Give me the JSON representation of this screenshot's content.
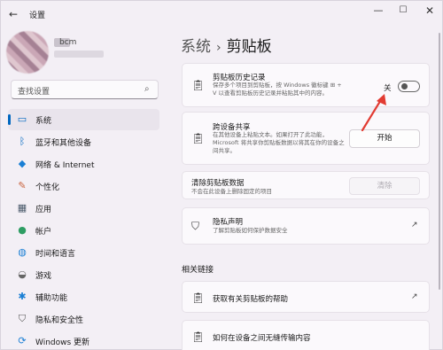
{
  "window": {
    "title": "设置",
    "controls": {
      "minimize": "—",
      "maximize": "☐",
      "close": "✕"
    }
  },
  "account": {
    "name": "bcm"
  },
  "search": {
    "placeholder": "查找设置"
  },
  "nav": {
    "items": [
      {
        "label": "系统",
        "icon": "monitor-icon",
        "active": true
      },
      {
        "label": "蓝牙和其他设备",
        "icon": "bluetooth-icon"
      },
      {
        "label": "网络 & Internet",
        "icon": "wifi-icon"
      },
      {
        "label": "个性化",
        "icon": "brush-icon"
      },
      {
        "label": "应用",
        "icon": "apps-icon"
      },
      {
        "label": "帐户",
        "icon": "person-icon"
      },
      {
        "label": "时间和语言",
        "icon": "globe-clock-icon"
      },
      {
        "label": "游戏",
        "icon": "gamepad-icon"
      },
      {
        "label": "辅助功能",
        "icon": "accessibility-icon"
      },
      {
        "label": "隐私和安全性",
        "icon": "shield-icon"
      },
      {
        "label": "Windows 更新",
        "icon": "update-icon"
      }
    ]
  },
  "breadcrumb": {
    "parent": "系统",
    "separator": "›",
    "current": "剪贴板"
  },
  "cards": {
    "history": {
      "title": "剪贴板历史记录",
      "desc": "保存多个项目到剪贴板，按 Windows 徽标键 ⊞ + V 以查看剪贴板历史记录并粘贴其中的内容。",
      "toggle_label": "关",
      "toggle_on": false
    },
    "sync": {
      "title": "跨设备共享",
      "desc": "在其他设备上粘贴文本。如果打开了此功能，Microsoft 将共享你剪贴板数据以将其在你的设备之间共享。",
      "button": "开始"
    },
    "clear": {
      "title": "清除剪贴板数据",
      "desc": "不会在此设备上删除固定的项目",
      "button": "清除"
    },
    "privacy": {
      "title": "隐私声明",
      "desc": "了解剪贴板如何保护数据安全"
    }
  },
  "related": {
    "title": "相关链接",
    "links": [
      {
        "label": "获取有关剪贴板的帮助"
      },
      {
        "label": "如何在设备之间无缝传输内容"
      }
    ]
  },
  "colors": {
    "accent": "#0067c0",
    "annotation": "#e23b32"
  }
}
